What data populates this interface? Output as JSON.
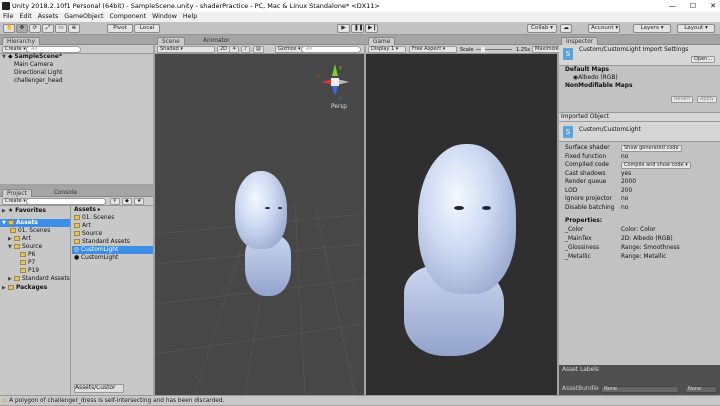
{
  "window": {
    "title": "Unity 2018.2.10f1 Personal (64bit) - SampleScene.unity - shaderPractice - PC, Mac & Linux Standalone* <DX11>",
    "minimize": "—",
    "maximize": "☐",
    "close": "✕"
  },
  "menu": [
    "File",
    "Edit",
    "Assets",
    "GameObject",
    "Component",
    "Window",
    "Help"
  ],
  "toolbar": {
    "pivot": "Pivot",
    "local": "Local",
    "collab": "Collab",
    "account": "Account",
    "layers": "Layers",
    "layout": "Layout"
  },
  "hierarchy": {
    "tab": "Hierarchy",
    "create": "Create",
    "search_placeholder": "All",
    "scene": "SampleScene*",
    "items": [
      "Main Camera",
      "Directional Light",
      "challenger_head"
    ]
  },
  "scene_view": {
    "tab_scene": "Scene",
    "tab_animator": "Animator",
    "shading": "Shaded",
    "mode2d": "2D",
    "gizmos": "Gizmos",
    "search_placeholder": "All",
    "persp": "Persp",
    "gizmo_y": "y",
    "gizmo_x": "x",
    "gizmo_z": "z"
  },
  "game_view": {
    "tab": "Game",
    "display": "Display 1",
    "aspect": "Free Aspect",
    "scale_label": "Scale",
    "scale_value": "1.25x",
    "maximize": "Maximize"
  },
  "project": {
    "tab_project": "Project",
    "tab_console": "Console",
    "create": "Create",
    "favorites": "Favorites",
    "tree": [
      "Assets",
      "01. Scenes",
      "Art",
      "Source",
      "P6",
      "P7",
      "P19",
      "Standard Assets",
      "Packages"
    ],
    "assets_header": "Assets",
    "files": [
      "01. Scenes",
      "Art",
      "Source",
      "Standard Assets",
      "CustomLight",
      "CustomLight"
    ],
    "path": "Assets/Custor"
  },
  "inspector": {
    "tab": "Inspector",
    "title": "Custom/CustomLight Import Settings",
    "open": "Open...",
    "default_maps": "Default Maps",
    "albedo": "Albedo (RGB)",
    "nonmod_maps": "NonModifiable Maps",
    "revert": "Revert",
    "apply": "Apply",
    "imported_object": "Imported Object",
    "shader_name": "Custom/CustomLight",
    "props": [
      {
        "k": "Surface shader",
        "v": "Show generated code"
      },
      {
        "k": "Fixed function",
        "v": "no"
      },
      {
        "k": "Compiled code",
        "v": "Compile and show code"
      },
      {
        "k": "Cast shadows",
        "v": "yes"
      },
      {
        "k": "Render queue",
        "v": "2000"
      },
      {
        "k": "LOD",
        "v": "200"
      },
      {
        "k": "Ignore projector",
        "v": "no"
      },
      {
        "k": "Disable batching",
        "v": "no"
      }
    ],
    "properties_label": "Properties:",
    "shader_props": [
      {
        "k": "_Color",
        "v": "Color: Color"
      },
      {
        "k": "_MainTex",
        "v": "2D: Albedo (RGB)"
      },
      {
        "k": "_Glossiness",
        "v": "Range: Smoothness"
      },
      {
        "k": "_Metallic",
        "v": "Range: Metallic"
      }
    ],
    "asset_labels": "Asset Labels",
    "asset_bundle": "AssetBundle",
    "bundle_none": "None",
    "variant_none": "None"
  },
  "status": "A polygon of challenger_dress is self-intersecting and has been discarded."
}
